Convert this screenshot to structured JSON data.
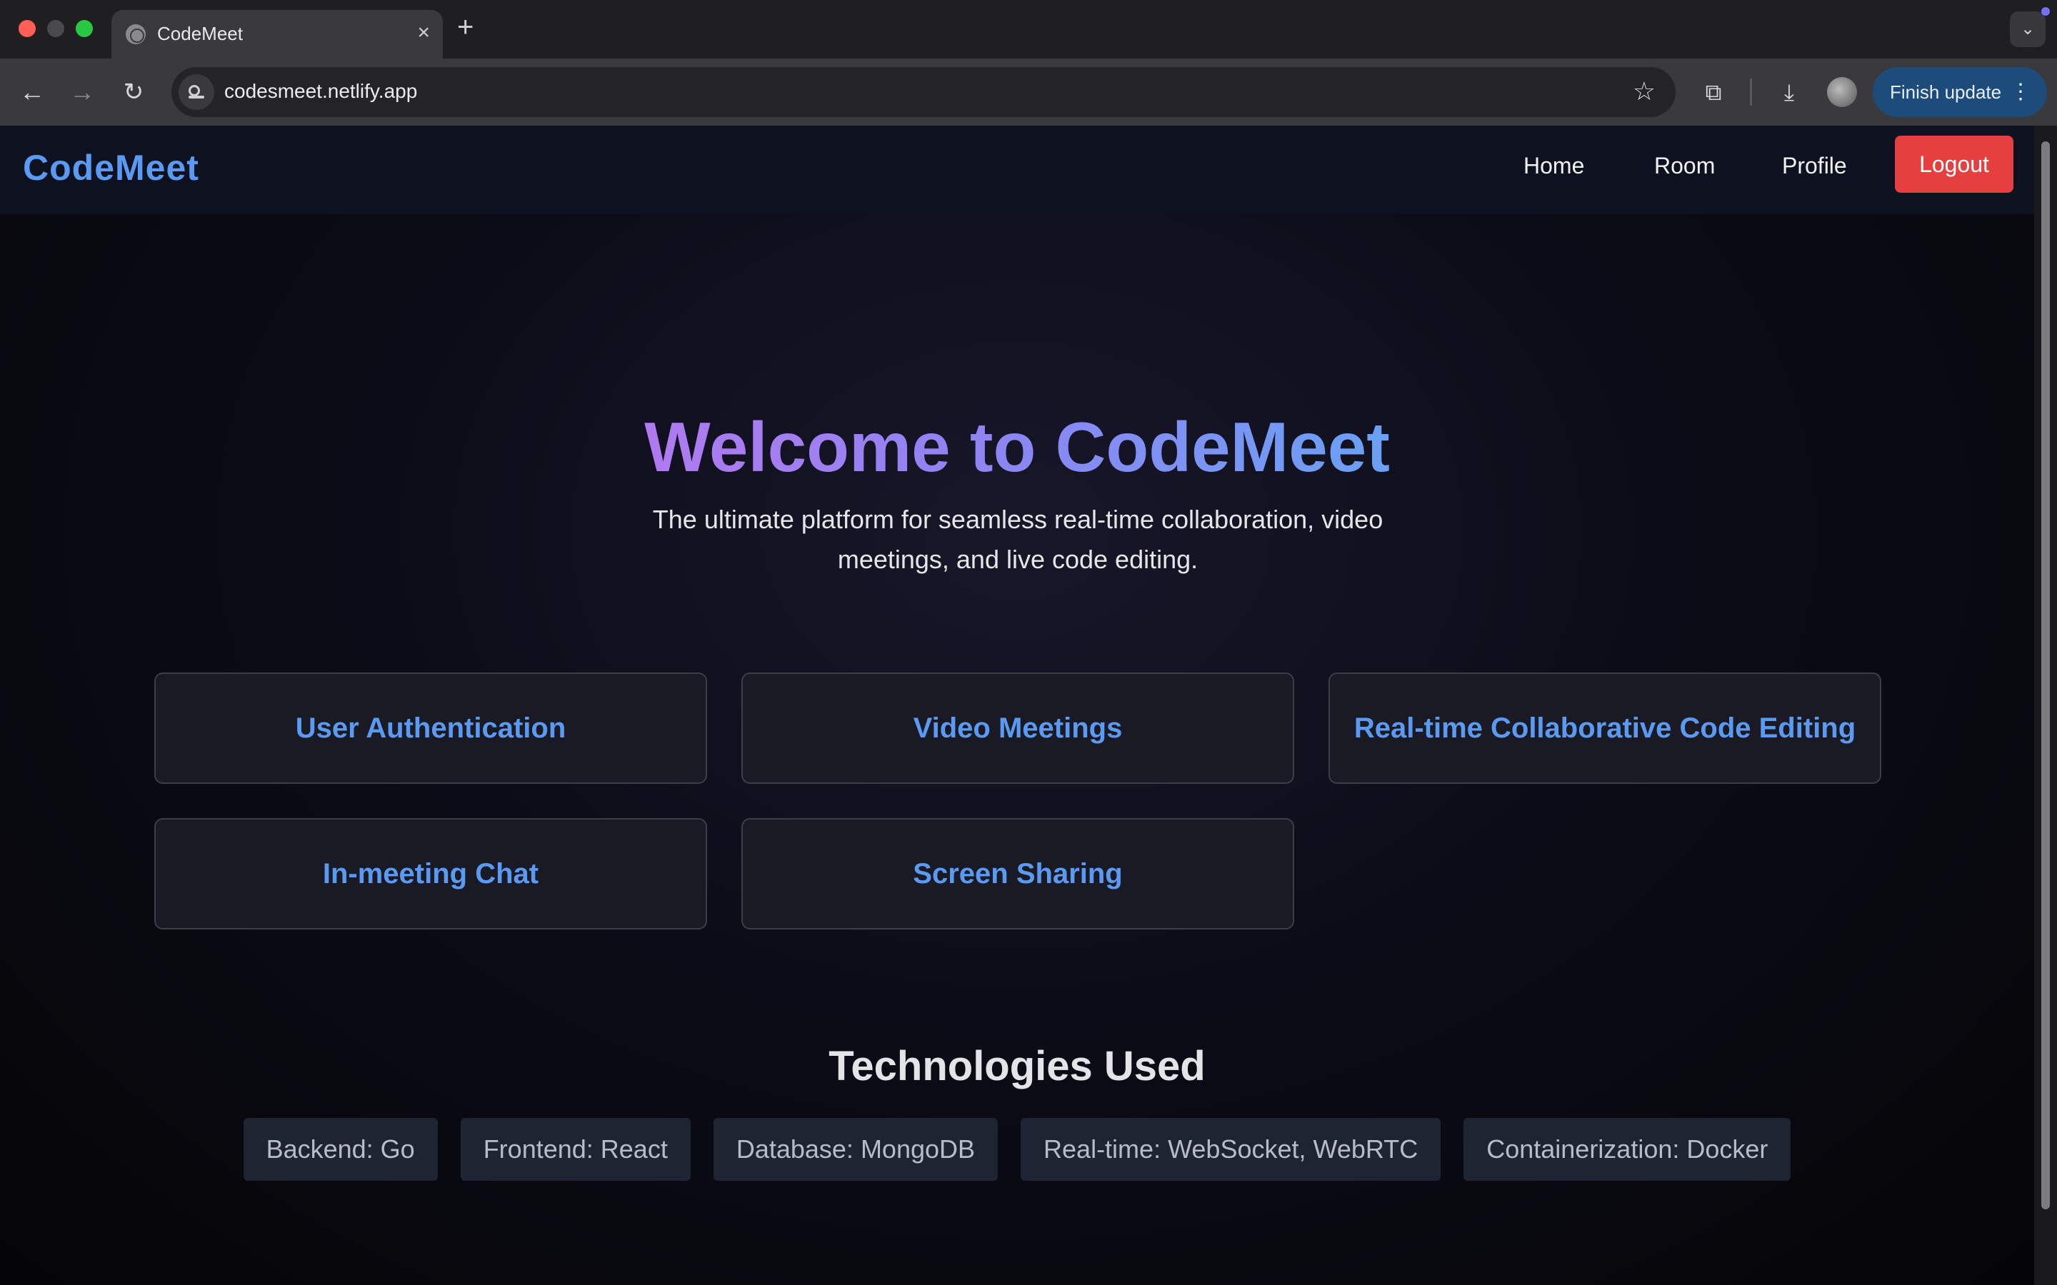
{
  "browser": {
    "tab_title": "CodeMeet",
    "tab_close": "×",
    "new_tab": "+",
    "url": "codesmeet.netlify.app",
    "finish_update_label": "Finish update",
    "icons": [
      "globe-icon",
      "back-icon",
      "forward-icon",
      "reload-icon",
      "site-info-icon",
      "star-icon",
      "extensions-icon",
      "download-icon",
      "profile-avatar",
      "menu-kebab-icon"
    ]
  },
  "nav": {
    "brand": "CodeMeet",
    "links": [
      "Home",
      "Room",
      "Profile"
    ],
    "logout": "Logout"
  },
  "hero": {
    "title": "Welcome to CodeMeet",
    "subtitle": "The ultimate platform for seamless real-time collaboration, video meetings, and live code editing."
  },
  "features": [
    "User Authentication",
    "Video Meetings",
    "Real-time Collaborative Code Editing",
    "In-meeting Chat",
    "Screen Sharing"
  ],
  "technologies": {
    "title": "Technologies Used",
    "items": [
      "Backend: Go",
      "Frontend: React",
      "Database: MongoDB",
      "Real-time: WebSocket, WebRTC",
      "Containerization: Docker"
    ]
  },
  "colors": {
    "accent": "#5b9af2",
    "logout": "#e63f3f",
    "gradient_start": "#b07af0",
    "gradient_end": "#6aa1f5"
  }
}
